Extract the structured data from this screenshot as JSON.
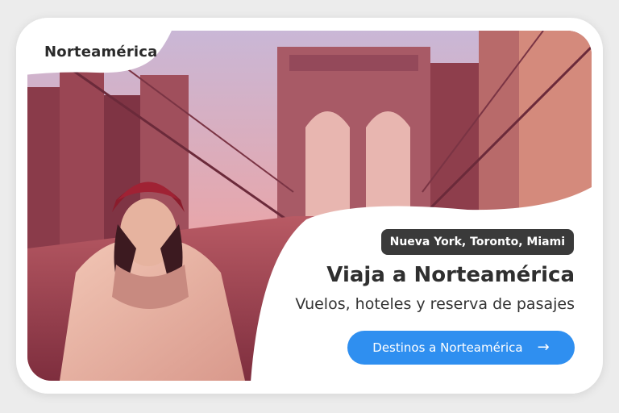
{
  "region_tab": {
    "label": "Norteamérica"
  },
  "hero": {
    "cities": "Nueva York, Toronto, Miami",
    "title": "Viaja a Norteamérica",
    "subtitle": "Vuelos, hoteles y reserva de pasajes"
  },
  "cta": {
    "label": "Destinos a Norteamérica",
    "icon": "arrow-right-icon"
  },
  "colors": {
    "accent": "#2f8ff0",
    "badge": "#3a3a3a",
    "photo_tone": "#c86a6a"
  }
}
